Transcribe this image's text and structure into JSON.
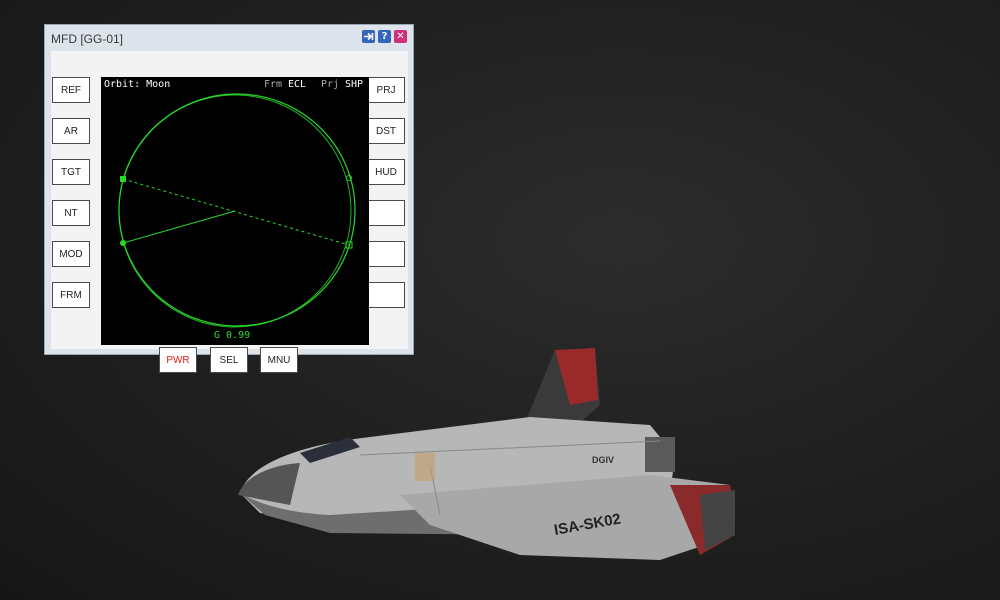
{
  "window": {
    "title": "MFD [GG-01]",
    "icons": [
      "pin-icon",
      "help-icon",
      "close-icon"
    ],
    "help_glyph": "?",
    "close_glyph": "✕"
  },
  "left_buttons": [
    "REF",
    "AR",
    "TGT",
    "NT",
    "MOD",
    "FRM"
  ],
  "right_buttons": [
    "PRJ",
    "DST",
    "HUD",
    "",
    "",
    ""
  ],
  "bottom_buttons": [
    "PWR",
    "SEL",
    "MNU"
  ],
  "display": {
    "orbit_label": "Orbit: Moon",
    "frm_label": "Frm",
    "frm_value": "ECL",
    "prj_label": "Prj",
    "prj_value": "SHP",
    "g_readout": "G 0.99"
  },
  "ship": {
    "registration": "ISA-SK02",
    "model": "DGIV"
  },
  "colors": {
    "orbit_green": "#2ad82a",
    "pwr_red": "#e02020",
    "screen_bg": "#000000"
  }
}
